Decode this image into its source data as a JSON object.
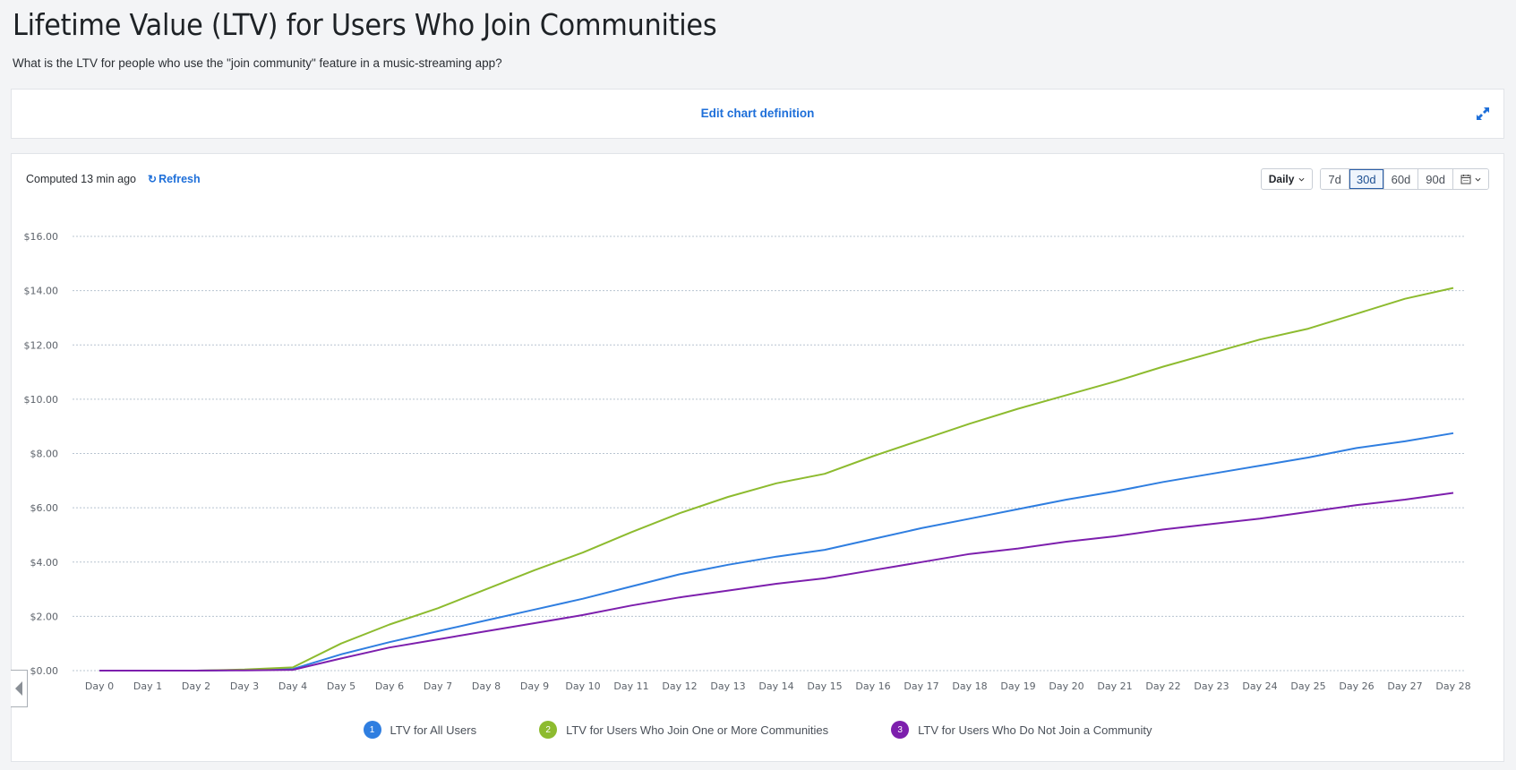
{
  "page": {
    "title": "Lifetime Value (LTV) for Users Who Join Communities",
    "subtitle": "What is the LTV for people who use the \"join community\" feature in a music-streaming app?"
  },
  "edit_bar": {
    "edit_label": "Edit chart definition",
    "expand_icon": "expand-icon"
  },
  "toolbar": {
    "computed_text": "Computed 13 min ago",
    "refresh_label": "Refresh",
    "interval_label": "Daily",
    "ranges": [
      "7d",
      "30d",
      "60d",
      "90d"
    ],
    "active_range": "30d",
    "calendar_icon": "calendar-icon"
  },
  "colors": {
    "series1": "#2f7ee0",
    "series2": "#8dbb2f",
    "series3": "#7d1fad",
    "grid": "#b8c4d0",
    "accent": "#1e6fd9"
  },
  "chart_data": {
    "type": "line",
    "title": "",
    "xlabel": "",
    "ylabel": "",
    "ylim": [
      0,
      16
    ],
    "yticks": [
      "$0.00",
      "$2.00",
      "$4.00",
      "$6.00",
      "$8.00",
      "$10.00",
      "$12.00",
      "$14.00",
      "$16.00"
    ],
    "ytick_values": [
      0,
      2,
      4,
      6,
      8,
      10,
      12,
      14,
      16
    ],
    "grid": true,
    "legend_position": "bottom",
    "x": [
      "Day 0",
      "Day 1",
      "Day 2",
      "Day 3",
      "Day 4",
      "Day 5",
      "Day 6",
      "Day 7",
      "Day 8",
      "Day 9",
      "Day 10",
      "Day 11",
      "Day 12",
      "Day 13",
      "Day 14",
      "Day 15",
      "Day 16",
      "Day 17",
      "Day 18",
      "Day 19",
      "Day 20",
      "Day 21",
      "Day 22",
      "Day 23",
      "Day 24",
      "Day 25",
      "Day 26",
      "Day 27",
      "Day 28"
    ],
    "series": [
      {
        "index": "1",
        "name": "LTV for All Users",
        "values": [
          0,
          0,
          0,
          0.02,
          0.06,
          0.6,
          1.05,
          1.45,
          1.85,
          2.25,
          2.65,
          3.1,
          3.55,
          3.9,
          4.2,
          4.45,
          4.85,
          5.25,
          5.6,
          5.95,
          6.3,
          6.6,
          6.95,
          7.25,
          7.55,
          7.85,
          8.2,
          8.45,
          8.75
        ]
      },
      {
        "index": "2",
        "name": "LTV for Users Who Join One or More Communities",
        "values": [
          0,
          0,
          0,
          0.04,
          0.12,
          1.0,
          1.7,
          2.3,
          3.0,
          3.7,
          4.35,
          5.1,
          5.8,
          6.4,
          6.9,
          7.25,
          7.9,
          8.5,
          9.1,
          9.65,
          10.15,
          10.65,
          11.2,
          11.7,
          12.2,
          12.6,
          13.15,
          13.7,
          14.1
        ]
      },
      {
        "index": "3",
        "name": "LTV for Users Who Do Not Join a Community",
        "values": [
          0,
          0,
          0,
          0.01,
          0.03,
          0.45,
          0.85,
          1.15,
          1.45,
          1.75,
          2.05,
          2.4,
          2.7,
          2.95,
          3.2,
          3.4,
          3.7,
          4.0,
          4.3,
          4.5,
          4.75,
          4.95,
          5.2,
          5.4,
          5.6,
          5.85,
          6.1,
          6.3,
          6.55
        ]
      }
    ]
  }
}
